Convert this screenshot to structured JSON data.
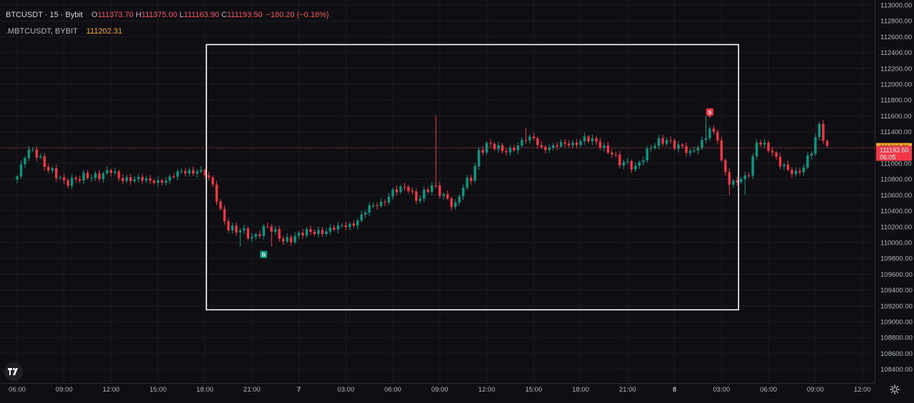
{
  "legend": {
    "symbol": "BTCUSDT · 15 · Bybit",
    "open_label": "O",
    "open": "111373.70",
    "high_label": "H",
    "high": "111375.00",
    "low_label": "L",
    "low": "111163.90",
    "close_label": "C",
    "close": "111193.50",
    "change": "−180.20 (−0.16%)",
    "index_symbol": ".MBTCUSDT, BYBIT",
    "index_value": "111202.31"
  },
  "price_badges": {
    "index_price": "111202.31",
    "last_price": "111193.50",
    "countdown": "06:05"
  },
  "markers": [
    {
      "label": "B",
      "type": "buy",
      "color": "#089981"
    },
    {
      "label": "S",
      "type": "sell",
      "color": "#f23645"
    }
  ],
  "colors": {
    "up": "#089981",
    "down": "#f23645",
    "background": "#0f0f13",
    "grid": "#1c1c22",
    "text": "#b2b5be",
    "index_badge": "#f5a623",
    "last_badge": "#f23645",
    "rect": "#ffffff"
  },
  "icons": {
    "logo": "tradingview-logo-icon",
    "settings": "gear-icon"
  },
  "chart_data": {
    "type": "candlestick",
    "ylim": [
      108300,
      113000
    ],
    "y_ticks": [
      108400,
      108600,
      108800,
      109000,
      109200,
      109400,
      109600,
      109800,
      110000,
      110200,
      110400,
      110600,
      110800,
      111000,
      111200,
      111400,
      111600,
      111800,
      112000,
      112200,
      112400,
      112600,
      112800,
      113000
    ],
    "y_tick_labels": [
      "108400.00",
      "108600.00",
      "108800.00",
      "109000.00",
      "109200.00",
      "109400.00",
      "109600.00",
      "109800.00",
      "110000.00",
      "110200.00",
      "110400.00",
      "110600.00",
      "110800.00",
      "111000.00",
      "111200.00",
      "111400.00",
      "111600.00",
      "111800.00",
      "112000.00",
      "112200.00",
      "112400.00",
      "112600.00",
      "112800.00",
      "113000.00"
    ],
    "x_tick_labels": [
      "06:00",
      "09:00",
      "12:00",
      "15:00",
      "18:00",
      "21:00",
      "7",
      "03:00",
      "06:00",
      "09:00",
      "12:00",
      "15:00",
      "18:00",
      "21:00",
      "8",
      "03:00",
      "06:00",
      "09:00",
      "12:00"
    ],
    "x_tick_index": [
      0,
      12,
      24,
      36,
      48,
      60,
      72,
      84,
      96,
      108,
      120,
      132,
      144,
      156,
      168,
      180,
      192,
      204,
      216
    ],
    "interval_minutes": 15,
    "start_time": "06:00",
    "anchors": [
      [
        0,
        110800
      ],
      [
        2,
        111100
      ],
      [
        4,
        111200
      ],
      [
        6,
        111050
      ],
      [
        8,
        110900
      ],
      [
        10,
        110850
      ],
      [
        12,
        110780
      ],
      [
        16,
        110800
      ],
      [
        20,
        110850
      ],
      [
        24,
        110900
      ],
      [
        26,
        110800
      ],
      [
        30,
        110820
      ],
      [
        34,
        110760
      ],
      [
        38,
        110800
      ],
      [
        42,
        110880
      ],
      [
        46,
        110920
      ],
      [
        48,
        110870
      ],
      [
        50,
        110700
      ],
      [
        52,
        110400
      ],
      [
        54,
        110200
      ],
      [
        56,
        110150
      ],
      [
        58,
        110120
      ],
      [
        60,
        110060
      ],
      [
        62,
        110150
      ],
      [
        64,
        110200
      ],
      [
        66,
        110100
      ],
      [
        68,
        110030
      ],
      [
        72,
        110100
      ],
      [
        78,
        110150
      ],
      [
        82,
        110180
      ],
      [
        86,
        110250
      ],
      [
        90,
        110430
      ],
      [
        93,
        110500
      ],
      [
        96,
        110650
      ],
      [
        100,
        110680
      ],
      [
        102,
        110560
      ],
      [
        106,
        110700
      ],
      [
        110,
        110560
      ],
      [
        112,
        110470
      ],
      [
        114,
        110700
      ],
      [
        116,
        110800
      ],
      [
        118,
        111150
      ],
      [
        120,
        111250
      ],
      [
        124,
        111150
      ],
      [
        126,
        111180
      ],
      [
        130,
        111300
      ],
      [
        132,
        111300
      ],
      [
        134,
        111200
      ],
      [
        138,
        111220
      ],
      [
        142,
        111250
      ],
      [
        145,
        111320
      ],
      [
        148,
        111250
      ],
      [
        152,
        111150
      ],
      [
        154,
        111000
      ],
      [
        158,
        110950
      ],
      [
        160,
        111100
      ],
      [
        162,
        111200
      ],
      [
        166,
        111300
      ],
      [
        168,
        111250
      ],
      [
        170,
        111200
      ],
      [
        172,
        111100
      ],
      [
        175,
        111280
      ],
      [
        177,
        111450
      ],
      [
        179,
        111300
      ],
      [
        180,
        111000
      ],
      [
        182,
        110750
      ],
      [
        184,
        110800
      ],
      [
        187,
        110850
      ],
      [
        189,
        111250
      ],
      [
        191,
        111250
      ],
      [
        193,
        111150
      ],
      [
        195,
        110980
      ],
      [
        197,
        110900
      ],
      [
        199,
        110880
      ],
      [
        201,
        110980
      ],
      [
        203,
        111150
      ],
      [
        205,
        111450
      ],
      [
        207,
        111200
      ]
    ],
    "high_spikes": [
      [
        107,
        111600
      ],
      [
        130,
        111450
      ],
      [
        176,
        111600
      ],
      [
        206,
        111550
      ]
    ],
    "low_spikes": [
      [
        57,
        109950
      ],
      [
        65,
        109950
      ],
      [
        182,
        110600
      ],
      [
        186,
        110600
      ]
    ],
    "markers": [
      {
        "label": "B",
        "candle_index": 63,
        "price": 109850
      },
      {
        "label": "S",
        "candle_index": 177,
        "price": 111650
      }
    ],
    "highlight_rectangle": {
      "from_index": 48,
      "to_index": 184,
      "top_price": 112500,
      "bottom_price": 109150
    },
    "last_price": 111193.5,
    "index_price": 111202.31
  }
}
